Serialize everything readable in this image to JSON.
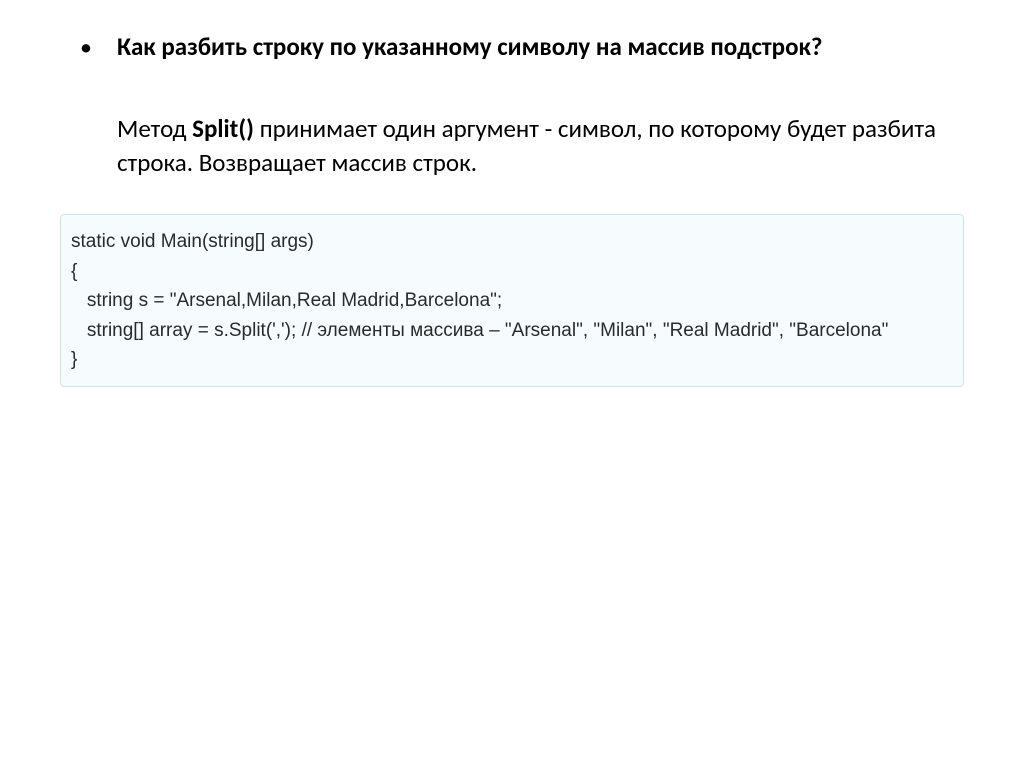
{
  "bullet": {
    "marker": "•",
    "question": "Как разбить строку по указанному символу на массив подстрок?",
    "answer_prefix": "Метод ",
    "answer_bold": "Split()",
    "answer_suffix": " принимает один аргумент - символ, по которому будет разбита строка. Возвращает массив строк."
  },
  "code": {
    "l1": "static void Main(string[] args)",
    "l2": "{",
    "l3": "   string s = \"Arsenal,Milan,Real Madrid,Barcelona\";",
    "l4": "   string[] array = s.Split(','); // элементы массива – \"Arsenal\", \"Milan\", \"Real Madrid\", \"Barcelona\"",
    "l5": "}"
  }
}
